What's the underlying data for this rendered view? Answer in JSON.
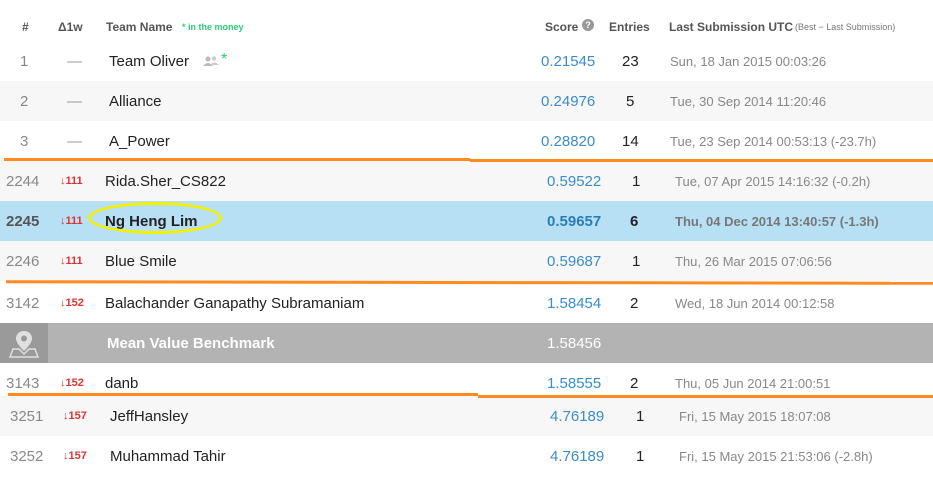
{
  "header": {
    "rank": "#",
    "delta": "Δ1w",
    "team": "Team Name",
    "money_note": "* in the money",
    "score": "Score",
    "score_help": "?",
    "entries": "Entries",
    "last": "Last Submission UTC",
    "last_note": "(Best − Last Submission)"
  },
  "rows": [
    {
      "rank": "1",
      "delta": "—",
      "team": "Team Oliver",
      "star": "*",
      "score": "0.21545",
      "entries": "23",
      "when": "Sun, 18 Jan 2015 00:03:26"
    },
    {
      "rank": "2",
      "delta": "—",
      "team": "Alliance",
      "score": "0.24976",
      "entries": "5",
      "when": "Tue, 30 Sep 2014 11:20:46"
    },
    {
      "rank": "3",
      "delta": "—",
      "team": "A_Power",
      "score": "0.28820",
      "entries": "14",
      "when": "Tue, 23 Sep 2014 00:53:13 (-23.7h)"
    },
    {
      "rank": "2244",
      "delta": "111",
      "team": "Rida.Sher_CS822",
      "score": "0.59522",
      "entries": "1",
      "when": "Tue, 07 Apr 2015 14:16:32 (-0.2h)"
    },
    {
      "rank": "2245",
      "delta": "111",
      "team": "Ng Heng Lim",
      "score": "0.59657",
      "entries": "6",
      "when": "Thu, 04 Dec 2014 13:40:57 (-1.3h)"
    },
    {
      "rank": "2246",
      "delta": "111",
      "team": "Blue Smile",
      "score": "0.59687",
      "entries": "1",
      "when": "Thu, 26 Mar 2015 07:06:56"
    },
    {
      "rank": "3142",
      "delta": "152",
      "team": "Balachander Ganapathy Subramaniam",
      "score": "1.58454",
      "entries": "2",
      "when": "Wed, 18 Jun 2014 00:12:58"
    },
    {
      "team": "Mean Value Benchmark",
      "score": "1.58456"
    },
    {
      "rank": "3143",
      "delta": "152",
      "team": "danb",
      "score": "1.58555",
      "entries": "2",
      "when": "Thu, 05 Jun 2014 21:00:51"
    },
    {
      "rank": "3251",
      "delta": "157",
      "team": "JeffHansley",
      "score": "4.76189",
      "entries": "1",
      "when": "Fri, 15 May 2015 18:07:08"
    },
    {
      "rank": "3252",
      "delta": "157",
      "team": "Muhammad Tahir",
      "score": "4.76189",
      "entries": "1",
      "when": "Fri, 15 May 2015 21:53:06 (-2.8h)"
    }
  ],
  "colors": {
    "highlight_row": "#b8e0f5",
    "benchmark_row": "#b3b3b3",
    "score_text": "#3a8dc8",
    "delta_down": "#dd3333",
    "annotation_line": "#ff8a1f",
    "annotation_ellipse": "#f4f100"
  },
  "icons": {
    "team_members": "people-icon",
    "benchmark": "map-pin-icon",
    "delta_down": "arrow-down-icon"
  }
}
